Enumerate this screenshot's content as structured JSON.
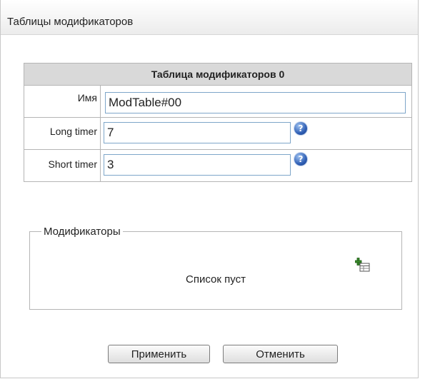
{
  "panel": {
    "title": "Таблицы модификаторов"
  },
  "table": {
    "header": "Таблица модификаторов 0",
    "rows": {
      "name": {
        "label": "Имя",
        "value": "ModTable#00"
      },
      "long_timer": {
        "label": "Long timer",
        "value": "7",
        "help_icon": "help-icon"
      },
      "short_timer": {
        "label": "Short timer",
        "value": "3",
        "help_icon": "help-icon"
      }
    }
  },
  "modifiers": {
    "legend": "Модификаторы",
    "empty_text": "Список пуст",
    "add_icon": "add-row-icon"
  },
  "buttons": {
    "apply": "Применить",
    "cancel": "Отменить"
  },
  "colors": {
    "table_header_bg": "#d9d9d9",
    "input_border": "#7ea6c9",
    "help_icon": "#2f5fb5"
  }
}
